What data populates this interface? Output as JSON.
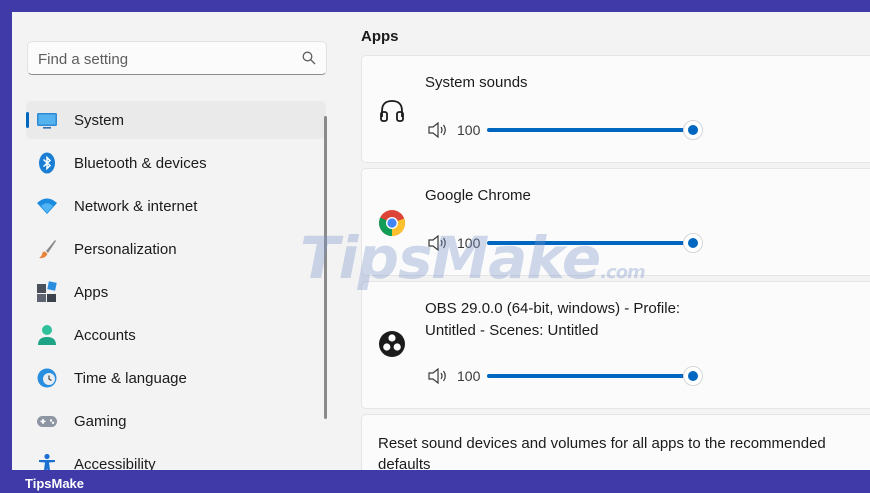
{
  "search": {
    "placeholder": "Find a setting"
  },
  "sidebar": {
    "items": [
      {
        "label": "System",
        "icon": "system-icon",
        "selected": true
      },
      {
        "label": "Bluetooth & devices",
        "icon": "bluetooth-icon"
      },
      {
        "label": "Network & internet",
        "icon": "wifi-icon"
      },
      {
        "label": "Personalization",
        "icon": "brush-icon"
      },
      {
        "label": "Apps",
        "icon": "apps-icon"
      },
      {
        "label": "Accounts",
        "icon": "account-icon"
      },
      {
        "label": "Time & language",
        "icon": "clock-globe-icon"
      },
      {
        "label": "Gaming",
        "icon": "gamepad-icon"
      },
      {
        "label": "Accessibility",
        "icon": "accessibility-icon"
      }
    ]
  },
  "main": {
    "section_title": "Apps",
    "apps": [
      {
        "name": "System sounds",
        "icon": "headphones-icon",
        "volume": 100
      },
      {
        "name": "Google Chrome",
        "icon": "chrome-icon",
        "volume": 100
      },
      {
        "name_line1": "OBS 29.0.0 (64-bit, windows) - Profile:",
        "name_line2": "Untitled - Scenes: Untitled",
        "icon": "obs-icon",
        "volume": 100
      }
    ],
    "reset_text_line1": "Reset sound devices and volumes for all apps to the recommended",
    "reset_text_line2": "defaults"
  },
  "watermark": {
    "text": "TipsMake",
    "suffix": ".com"
  },
  "footer": {
    "brand": "TipsMake"
  },
  "colors": {
    "accent": "#0067c0",
    "frame_border": "#3f3aa8"
  }
}
